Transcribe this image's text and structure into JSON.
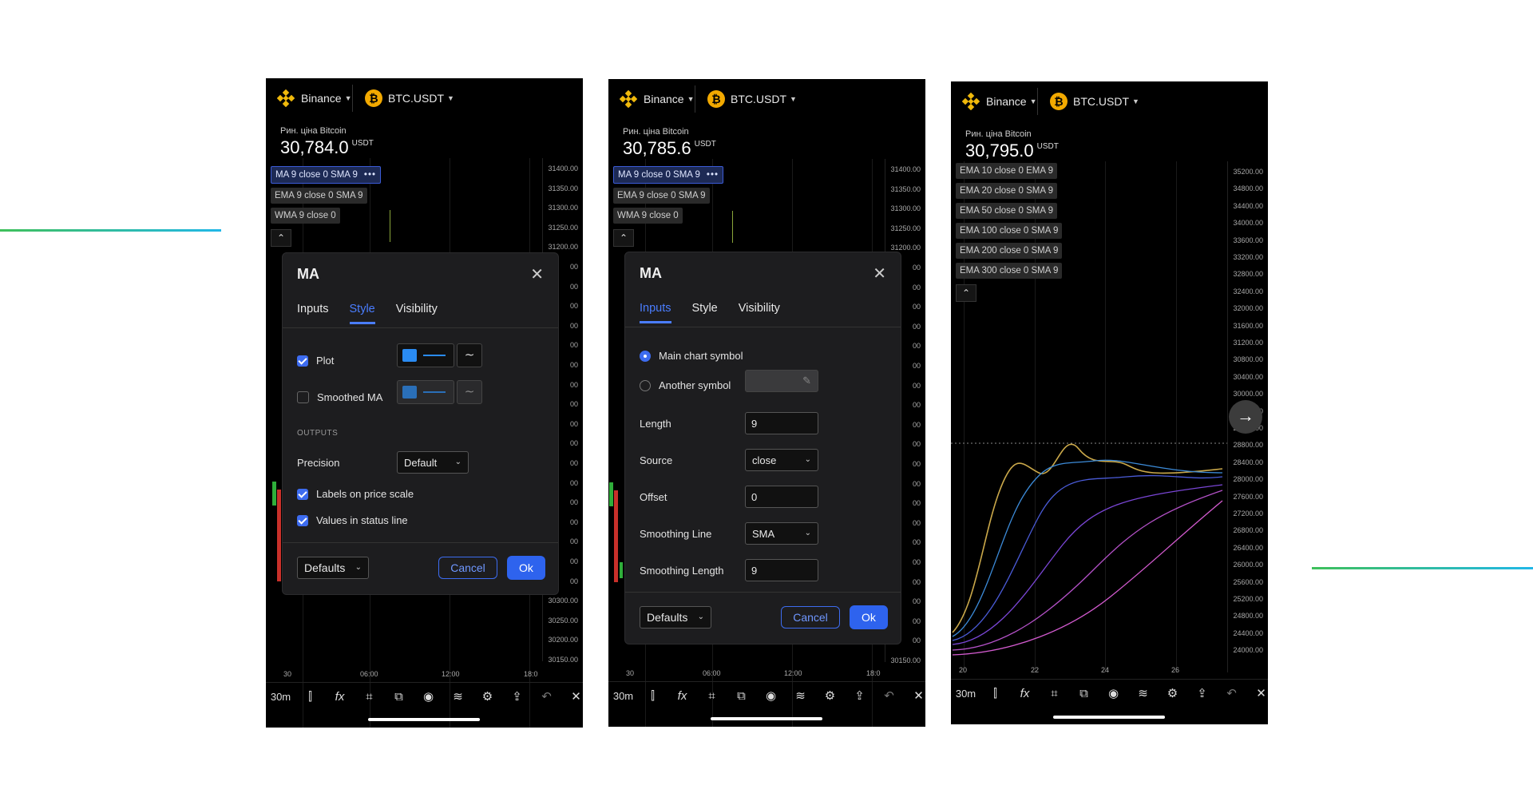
{
  "exchange": "Binance",
  "symbol": "BTC.USDT",
  "price_label": "Рин. ціна Bitcoin",
  "currency": "USDT",
  "phone1": {
    "price": "30,784.0",
    "indicators": [
      "MA 9 close 0 SMA 9",
      "EMA 9 close 0 SMA 9",
      "WMA 9 close 0"
    ],
    "axis": [
      "31400.00",
      "31350.00",
      "31300.00",
      "31250.00",
      "31200.00",
      "00",
      "00",
      "00",
      "00",
      "00",
      "00",
      "00",
      "00",
      "00",
      "00",
      "00",
      "00",
      "00",
      "00",
      "00",
      "00",
      "00",
      "30300.00",
      "30250.00",
      "30200.00",
      "30150.00"
    ],
    "x_labels": [
      "30",
      "06:00",
      "12:00",
      "18:0"
    ],
    "dialog": {
      "title": "MA",
      "tabs": [
        "Inputs",
        "Style",
        "Visibility"
      ],
      "active_tab": "Style",
      "plot_label": "Plot",
      "smoothed_label": "Smoothed MA",
      "outputs_header": "OUTPUTS",
      "precision_label": "Precision",
      "precision_value": "Default",
      "labels_on_price_scale": "Labels on price scale",
      "values_in_status_line": "Values in status line",
      "defaults": "Defaults",
      "cancel": "Cancel",
      "ok": "Ok"
    }
  },
  "phone2": {
    "price": "30,785.6",
    "indicators": [
      "MA 9 close 0 SMA 9",
      "EMA 9 close 0 SMA 9",
      "WMA 9 close 0"
    ],
    "axis": [
      "31400.00",
      "31350.00",
      "31300.00",
      "31250.00",
      "31200.00",
      "00",
      "00",
      "00",
      "00",
      "00",
      "00",
      "00",
      "00",
      "00",
      "00",
      "00",
      "00",
      "00",
      "00",
      "00",
      "00",
      "00",
      "00",
      "00",
      "00",
      "30150.00"
    ],
    "x_labels": [
      "30",
      "06:00",
      "12:00",
      "18:0"
    ],
    "dialog": {
      "title": "MA",
      "tabs": [
        "Inputs",
        "Style",
        "Visibility"
      ],
      "active_tab": "Inputs",
      "main_chart_symbol": "Main chart symbol",
      "another_symbol": "Another symbol",
      "length_label": "Length",
      "length_value": "9",
      "source_label": "Source",
      "source_value": "close",
      "offset_label": "Offset",
      "offset_value": "0",
      "smoothing_line_label": "Smoothing Line",
      "smoothing_line_value": "SMA",
      "smoothing_length_label": "Smoothing Length",
      "smoothing_length_value": "9",
      "defaults": "Defaults",
      "cancel": "Cancel",
      "ok": "Ok"
    }
  },
  "phone3": {
    "price": "30,795.0",
    "indicators": [
      "EMA 10 close 0 EMA 9",
      "EMA 20 close 0 SMA 9",
      "EMA 50 close 0 SMA 9",
      "EMA 100 close 0 SMA 9",
      "EMA 200 close 0 SMA 9",
      "EMA 300 close 0 SMA 9"
    ],
    "axis": [
      "35200.00",
      "34800.00",
      "34400.00",
      "34000.00",
      "33600.00",
      "33200.00",
      "32800.00",
      "32400.00",
      "32000.00",
      "31600.00",
      "31200.00",
      "30800.00",
      "30400.00",
      "30000.00",
      "29600.00",
      "29200.00",
      "28800.00",
      "28400.00",
      "28000.00",
      "27600.00",
      "27200.00",
      "26800.00",
      "26400.00",
      "26000.00",
      "25600.00",
      "25200.00",
      "24800.00",
      "24400.00",
      "24000.00"
    ],
    "x_labels": [
      "20",
      "22",
      "24",
      "26"
    ]
  },
  "toolbar": {
    "interval": "30m",
    "icons": [
      "candles-icon",
      "fx-icon",
      "drawing-icon",
      "template-icon",
      "eye-icon",
      "layers-icon",
      "gear-icon",
      "share-icon",
      "undo-icon",
      "close-icon"
    ]
  },
  "colors": {
    "accent": "#3d6cf0",
    "plot_color": "#2a8bf2",
    "binance": "#f0b90b",
    "btc": "#f2a900"
  }
}
